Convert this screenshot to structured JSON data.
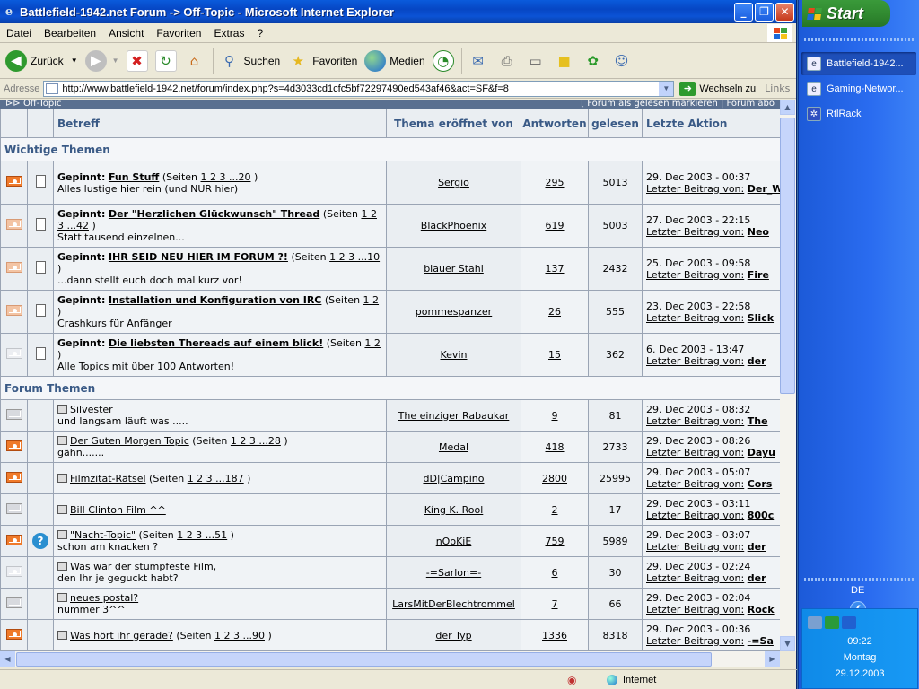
{
  "window": {
    "title": "Battlefield-1942.net Forum -> Off-Topic - Microsoft Internet Explorer",
    "minimize": "_",
    "maximize": "❐",
    "close": "✕"
  },
  "menu": [
    "Datei",
    "Bearbeiten",
    "Ansicht",
    "Favoriten",
    "Extras",
    "?"
  ],
  "toolbar": {
    "back": "Zurück",
    "search": "Suchen",
    "favorites": "Favoriten",
    "media": "Medien"
  },
  "address": {
    "label": "Adresse",
    "url": "http://www.battlefield-1942.net/forum/index.php?s=4d3033cd1cfc5bf72297490ed543af46&act=SF&f=8",
    "go": "Wechseln zu",
    "links": "Links"
  },
  "forum": {
    "name": "Off-Topic",
    "header_links": "[ Forum als gelesen markieren | Forum abo",
    "columns": [
      "Betreff",
      "Thema eröffnet von",
      "Antworten",
      "gelesen",
      "Letzte Aktion"
    ],
    "section_pinned": "Wichtige Themen",
    "section_topics": "Forum Themen",
    "last_by_label": "Letzter Beitrag von:",
    "pinned": [
      {
        "prefix": "Gepinnt:",
        "title": "Fun Stuff",
        "pages_pre": "(Seiten ",
        "pages": "1 2 3 ...20",
        "pages_post": " )",
        "desc": "Alles lustige hier rein (und NUR hier)",
        "author": "Sergio",
        "replies": "295",
        "views": "5013",
        "date": "29. Dec 2003 - 00:37",
        "last": "Der_Wüstenfuchs",
        "icon": "orange"
      },
      {
        "prefix": "Gepinnt:",
        "title": "Der \"Herzlichen Glückwunsch\" Thread",
        "pages_pre": "(Seiten ",
        "pages": "1 2 3 ...42",
        "pages_post": " )",
        "desc": "Statt tausend einzelnen...",
        "author": "BlackPhoenix",
        "replies": "619",
        "views": "5003",
        "date": "27. Dec 2003 - 22:15",
        "last": "Neo",
        "icon": "pale"
      },
      {
        "prefix": "Gepinnt:",
        "title": "IHR SEID NEU HIER IM FORUM ?!",
        "pages_pre": "(Seiten ",
        "pages": "1 2 3 ...10",
        "pages_post": " )",
        "desc": "...dann stellt euch doch mal kurz vor!",
        "author": "blauer Stahl",
        "replies": "137",
        "views": "2432",
        "date": "25. Dec 2003 - 09:58",
        "last": "Fire",
        "icon": "pale"
      },
      {
        "prefix": "Gepinnt:",
        "title": "Installation und Konfiguration von IRC",
        "pages_pre": "(Seiten ",
        "pages": "1 2",
        "pages_post": " )",
        "desc": "Crashkurs für Anfänger",
        "author": "pommespanzer",
        "replies": "26",
        "views": "555",
        "date": "23. Dec 2003 - 22:58",
        "last": "Slick",
        "icon": "pale"
      },
      {
        "prefix": "Gepinnt:",
        "title": "Die liebsten Thereads auf einem blick!",
        "pages_pre": "(Seiten ",
        "pages": "1 2",
        "pages_post": " )",
        "desc": "Alle Topics mit über 100 Antworten!",
        "author": "Kevin",
        "replies": "15",
        "views": "362",
        "date": "6. Dec 2003 - 13:47",
        "last": "der",
        "icon": "light"
      }
    ],
    "topics": [
      {
        "title": "Silvester",
        "pages_pre": "",
        "pages": "",
        "pages_post": "",
        "desc": "und langsam läuft was .....",
        "author": "The einziger Rabaukar",
        "replies": "9",
        "views": "81",
        "date": "29. Dec 2003 - 08:32",
        "last": "The",
        "icon": "grey",
        "icon2": ""
      },
      {
        "title": "Der Guten Morgen Topic",
        "pages_pre": " (Seiten ",
        "pages": "1 2 3 ...28",
        "pages_post": " )",
        "desc": "gähn.......",
        "author": "Medal",
        "replies": "418",
        "views": "2733",
        "date": "29. Dec 2003 - 08:26",
        "last": "Dayu",
        "icon": "orange",
        "icon2": ""
      },
      {
        "title": "Filmzitat-Rätsel",
        "pages_pre": " (Seiten ",
        "pages": "1 2 3 ...187",
        "pages_post": " )",
        "desc": "",
        "author": "dD|Campino",
        "replies": "2800",
        "views": "25995",
        "date": "29. Dec 2003 - 05:07",
        "last": "Cors",
        "icon": "orange",
        "icon2": ""
      },
      {
        "title": "Bill Clinton Film ^^",
        "pages_pre": "",
        "pages": "",
        "pages_post": "",
        "desc": "",
        "author": "Kíng K. Rool",
        "replies": "2",
        "views": "17",
        "date": "29. Dec 2003 - 03:11",
        "last": "800c",
        "icon": "grey",
        "icon2": ""
      },
      {
        "title": "\"Nacht-Topic\"",
        "pages_pre": " (Seiten ",
        "pages": "1 2 3 ...51",
        "pages_post": " )",
        "desc": "schon am knacken ?",
        "author": "nOoKiE",
        "replies": "759",
        "views": "5989",
        "date": "29. Dec 2003 - 03:07",
        "last": "der",
        "icon": "orange",
        "icon2": "?"
      },
      {
        "title": "Was war der stumpfeste Film,",
        "pages_pre": "",
        "pages": "",
        "pages_post": "",
        "desc": "den Ihr je geguckt habt?",
        "author": "-=Sarlon=-",
        "replies": "6",
        "views": "30",
        "date": "29. Dec 2003 - 02:24",
        "last": "der",
        "icon": "light",
        "icon2": ""
      },
      {
        "title": "neues postal?",
        "pages_pre": "",
        "pages": "",
        "pages_post": "",
        "desc": "nummer 3^^",
        "author": "LarsMitDerBlechtrommel",
        "replies": "7",
        "views": "66",
        "date": "29. Dec 2003 - 02:04",
        "last": "Rock",
        "icon": "grey",
        "icon2": ""
      },
      {
        "title": "Was hört ihr gerade?",
        "pages_pre": " (Seiten ",
        "pages": "1 2 3 ...90",
        "pages_post": " )",
        "desc": "",
        "author": "der Typ",
        "replies": "1336",
        "views": "8318",
        "date": "29. Dec 2003 - 00:36",
        "last": "-=Sa",
        "icon": "orange",
        "icon2": ""
      }
    ]
  },
  "status": {
    "zone": "Internet"
  },
  "taskbar": {
    "start": "Start",
    "tasks": [
      "Battlefield-1942...",
      "Gaming-Networ...",
      "RtlRack"
    ],
    "lang": "DE",
    "time": "09:22",
    "day": "Montag",
    "date": "29.12.2003"
  }
}
